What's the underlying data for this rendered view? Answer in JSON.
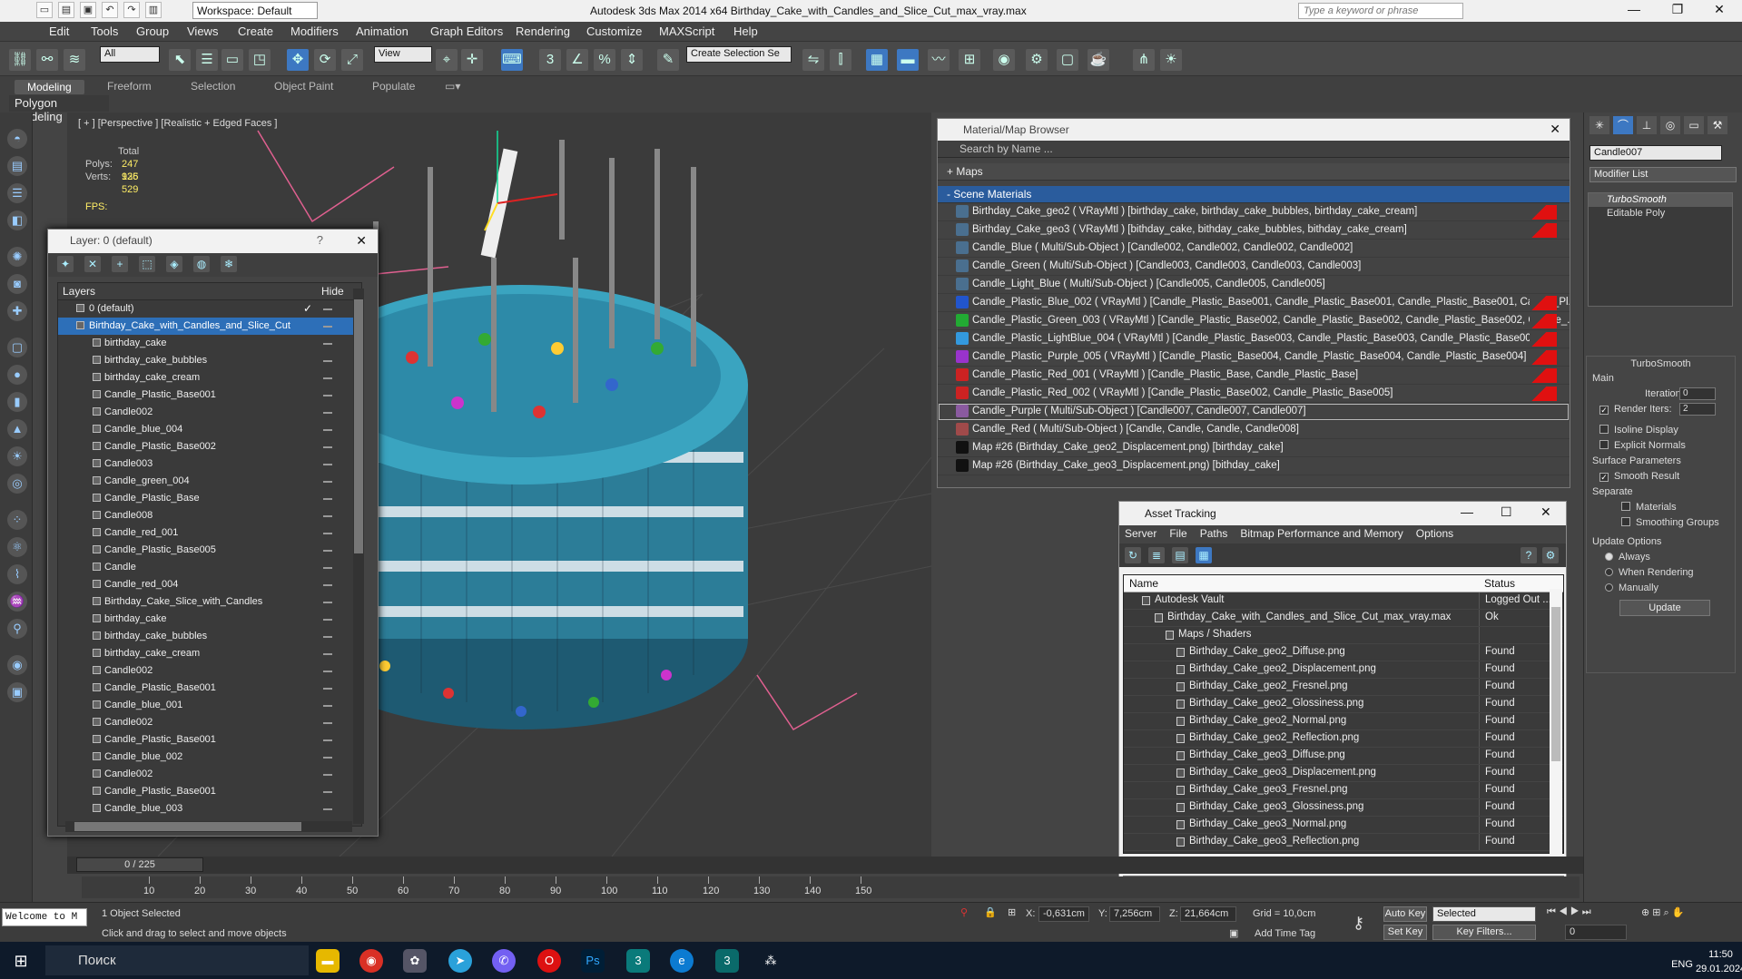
{
  "titlebar": {
    "workspace": "Workspace: Default",
    "title": "Autodesk 3ds Max  2014 x64      Birthday_Cake_with_Candles_and_Slice_Cut_max_vray.max",
    "search_placeholder": "Type a keyword or phrase"
  },
  "menu": [
    "Edit",
    "Tools",
    "Group",
    "Views",
    "Create",
    "Modifiers",
    "Animation",
    "Graph Editors",
    "Rendering",
    "Customize",
    "MAXScript",
    "Help"
  ],
  "toolbar": {
    "filter": "All",
    "ref_coord": "View",
    "selection_set": "Create Selection Se"
  },
  "ribbon": {
    "tabs": [
      "Modeling",
      "Freeform",
      "Selection",
      "Object Paint",
      "Populate"
    ],
    "sub": "Polygon Modeling"
  },
  "viewport": {
    "label": "[ + ] [Perspective ] [Realistic + Edged Faces ]",
    "total_label": "Total",
    "polys_label": "Polys:",
    "polys": "247 925",
    "verts_label": "Verts:",
    "verts": "136 529",
    "fps_label": "FPS:"
  },
  "layer_window": {
    "title": "Layer: 0 (default)",
    "help": "?",
    "col_layers": "Layers",
    "col_hide": "Hide",
    "rows": [
      {
        "name": "0 (default)",
        "kind": "layer",
        "check": "✓"
      },
      {
        "name": "Birthday_Cake_with_Candles_and_Slice_Cut",
        "kind": "layer",
        "selected": true
      },
      {
        "name": "birthday_cake"
      },
      {
        "name": "birthday_cake_bubbles"
      },
      {
        "name": "birthday_cake_cream"
      },
      {
        "name": "Candle_Plastic_Base001"
      },
      {
        "name": "Candle002"
      },
      {
        "name": "Candle_blue_004"
      },
      {
        "name": "Candle_Plastic_Base002"
      },
      {
        "name": "Candle003"
      },
      {
        "name": "Candle_green_004"
      },
      {
        "name": "Candle_Plastic_Base"
      },
      {
        "name": "Candle008"
      },
      {
        "name": "Candle_red_001"
      },
      {
        "name": "Candle_Plastic_Base005"
      },
      {
        "name": "Candle"
      },
      {
        "name": "Candle_red_004"
      },
      {
        "name": "Birthday_Cake_Slice_with_Candles"
      },
      {
        "name": "birthday_cake"
      },
      {
        "name": "birthday_cake_bubbles"
      },
      {
        "name": "birthday_cake_cream"
      },
      {
        "name": "Candle002"
      },
      {
        "name": "Candle_Plastic_Base001"
      },
      {
        "name": "Candle_blue_001"
      },
      {
        "name": "Candle002"
      },
      {
        "name": "Candle_Plastic_Base001"
      },
      {
        "name": "Candle_blue_002"
      },
      {
        "name": "Candle002"
      },
      {
        "name": "Candle_Plastic_Base001"
      },
      {
        "name": "Candle_blue_003"
      }
    ]
  },
  "material_browser": {
    "title": "Material/Map Browser",
    "search_placeholder": "Search by Name ...",
    "maps_group": "+ Maps",
    "scene_group": "- Scene Materials",
    "rows": [
      {
        "text": "Birthday_Cake_geo2  ( VRayMtl ) [birthday_cake, birthday_cake_bubbles, birthday_cake_cream]",
        "color": "#4a6f8f",
        "red": true
      },
      {
        "text": "Birthday_Cake_geo3  ( VRayMtl ) [bithday_cake, bithday_cake_bubbles, bithday_cake_cream]",
        "color": "#4a6f8f",
        "red": true
      },
      {
        "text": "Candle_Blue  ( Multi/Sub-Object ) [Candle002, Candle002, Candle002, Candle002]",
        "color": "#4a6f8f",
        "red": false
      },
      {
        "text": "Candle_Green  ( Multi/Sub-Object ) [Candle003, Candle003, Candle003, Candle003]",
        "color": "#4a6f8f",
        "red": false
      },
      {
        "text": "Candle_Light_Blue  ( Multi/Sub-Object ) [Candle005, Candle005, Candle005]",
        "color": "#4a6f8f",
        "red": false
      },
      {
        "text": "Candle_Plastic_Blue_002  ( VRayMtl ) [Candle_Plastic_Base001, Candle_Plastic_Base001, Candle_Plastic_Base001, Candle_Pl...",
        "color": "#2255cc",
        "red": true
      },
      {
        "text": "Candle_Plastic_Green_003  ( VRayMtl ) [Candle_Plastic_Base002, Candle_Plastic_Base002, Candle_Plastic_Base002, Candle_...",
        "color": "#22aa33",
        "red": true
      },
      {
        "text": "Candle_Plastic_LightBlue_004  ( VRayMtl ) [Candle_Plastic_Base003, Candle_Plastic_Base003, Candle_Plastic_Base003]",
        "color": "#3399dd",
        "red": true
      },
      {
        "text": "Candle_Plastic_Purple_005  ( VRayMtl ) [Candle_Plastic_Base004, Candle_Plastic_Base004, Candle_Plastic_Base004]",
        "color": "#9933cc",
        "red": true
      },
      {
        "text": "Candle_Plastic_Red_001  ( VRayMtl ) [Candle_Plastic_Base, Candle_Plastic_Base]",
        "color": "#cc2222",
        "red": true
      },
      {
        "text": "Candle_Plastic_Red_002  ( VRayMtl ) [Candle_Plastic_Base002, Candle_Plastic_Base005]",
        "color": "#cc2222",
        "red": true
      },
      {
        "text": "Candle_Purple  ( Multi/Sub-Object ) [Candle007, Candle007, Candle007]",
        "color": "#8a5aa0",
        "red": false,
        "selected": true
      },
      {
        "text": "Candle_Red  ( Multi/Sub-Object ) [Candle, Candle, Candle, Candle008]",
        "color": "#a04a4a",
        "red": false
      },
      {
        "text": "Map #26 (Birthday_Cake_geo2_Displacement.png) [birthday_cake]",
        "color": "#111111",
        "red": false
      },
      {
        "text": "Map #26 (Birthday_Cake_geo3_Displacement.png) [bithday_cake]",
        "color": "#111111",
        "red": false
      }
    ]
  },
  "command_panel": {
    "object_name": "Candle007",
    "modifier_list": "Modifier List",
    "stack": [
      "TurboSmooth",
      "Editable Poly"
    ],
    "rollout_title": "TurboSmooth",
    "main_label": "Main",
    "iterations_label": "Iterations:",
    "iterations": "0",
    "render_iters_label": "Render Iters:",
    "render_iters": "2",
    "isoline": "Isoline Display",
    "explicit": "Explicit Normals",
    "surface_params": "Surface Parameters",
    "smooth_result": "Smooth Result",
    "separate": "Separate",
    "materials": "Materials",
    "smoothing_groups": "Smoothing Groups",
    "update_options": "Update Options",
    "always": "Always",
    "when_rendering": "When Rendering",
    "manually": "Manually",
    "update_btn": "Update"
  },
  "asset_tracking": {
    "title": "Asset Tracking",
    "menu": [
      "Server",
      "File",
      "Paths",
      "Bitmap Performance and Memory",
      "Options"
    ],
    "col_name": "Name",
    "col_status": "Status",
    "rows": [
      {
        "name": "Autodesk Vault",
        "status": "Logged Out ...",
        "indent": 0
      },
      {
        "name": "Birthday_Cake_with_Candles_and_Slice_Cut_max_vray.max",
        "status": "Ok",
        "indent": 1
      },
      {
        "name": "Maps / Shaders",
        "status": "",
        "indent": 2
      },
      {
        "name": "Birthday_Cake_geo2_Diffuse.png",
        "status": "Found",
        "indent": 3
      },
      {
        "name": "Birthday_Cake_geo2_Displacement.png",
        "status": "Found",
        "indent": 3
      },
      {
        "name": "Birthday_Cake_geo2_Fresnel.png",
        "status": "Found",
        "indent": 3
      },
      {
        "name": "Birthday_Cake_geo2_Glossiness.png",
        "status": "Found",
        "indent": 3
      },
      {
        "name": "Birthday_Cake_geo2_Normal.png",
        "status": "Found",
        "indent": 3
      },
      {
        "name": "Birthday_Cake_geo2_Reflection.png",
        "status": "Found",
        "indent": 3
      },
      {
        "name": "Birthday_Cake_geo3_Diffuse.png",
        "status": "Found",
        "indent": 3
      },
      {
        "name": "Birthday_Cake_geo3_Displacement.png",
        "status": "Found",
        "indent": 3
      },
      {
        "name": "Birthday_Cake_geo3_Fresnel.png",
        "status": "Found",
        "indent": 3
      },
      {
        "name": "Birthday_Cake_geo3_Glossiness.png",
        "status": "Found",
        "indent": 3
      },
      {
        "name": "Birthday_Cake_geo3_Normal.png",
        "status": "Found",
        "indent": 3
      },
      {
        "name": "Birthday_Cake_geo3_Reflection.png",
        "status": "Found",
        "indent": 3
      }
    ]
  },
  "timeline": {
    "frame": "0 / 225",
    "ticks": [
      "10",
      "20",
      "30",
      "40",
      "50",
      "60",
      "70",
      "80",
      "90",
      "100",
      "110",
      "120",
      "130",
      "140",
      "150"
    ]
  },
  "status": {
    "welcome": "Welcome to M",
    "selected": "1 Object Selected",
    "prompt": "Click and drag to select and move objects",
    "x_label": "X:",
    "x": "-0,631cm",
    "y_label": "Y:",
    "y": "7,256cm",
    "z_label": "Z:",
    "z": "21,664cm",
    "grid": "Grid = 10,0cm",
    "auto_key": "Auto Key",
    "auto_key_mode": "Selected",
    "set_key": "Set Key",
    "key_filters": "Key Filters...",
    "add_time_tag": "Add Time Tag",
    "frame_field": "0"
  },
  "taskbar": {
    "search": "Поиск",
    "lang": "ENG",
    "time": "11:50",
    "date": "29.01.2024"
  }
}
